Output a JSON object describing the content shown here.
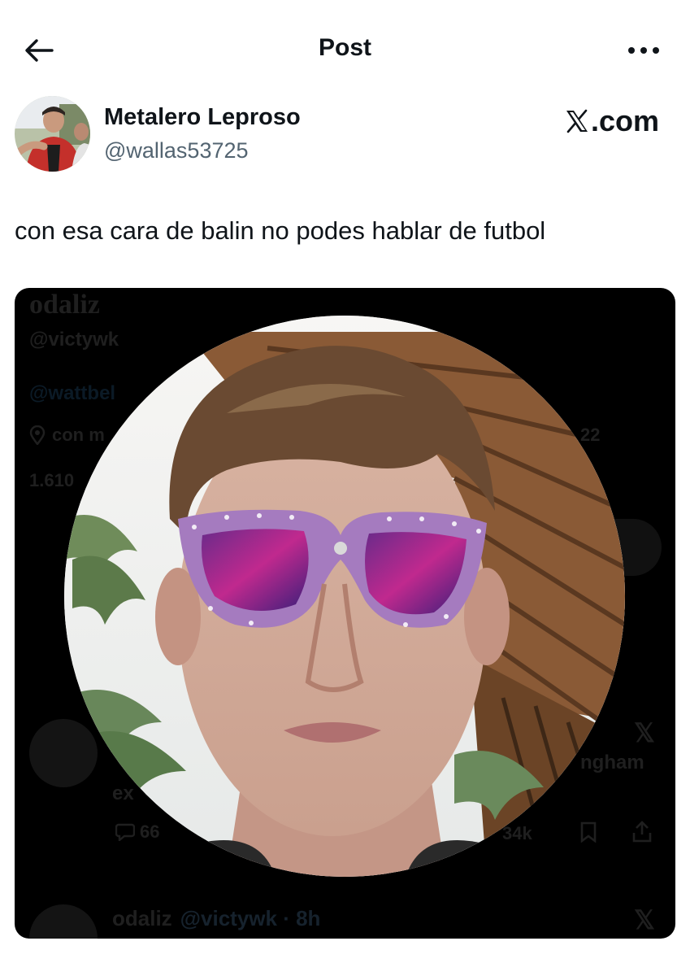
{
  "topbar": {
    "title": "Post",
    "back_icon": "arrow-left-icon",
    "more_icon": "more-horizontal-icon"
  },
  "author": {
    "display_name": "Metalero Leproso",
    "handle": "@wallas53725"
  },
  "watermark": {
    "text": ".com",
    "logo_icon": "x-logo-icon"
  },
  "tweet": {
    "text": "con esa cara de balin no podes hablar de futbol"
  },
  "embedded_screenshot": {
    "profile_name": "odaliz",
    "profile_handle": "@victywk",
    "mention": "@wattbel",
    "location_partial": "con m",
    "stat_partial": "1.610",
    "date_partial": "22",
    "reply_partial_1": "ngham",
    "reply_partial_2": "ex",
    "reply_count": "66",
    "like_count": "34k",
    "footer_name": "odaliz",
    "footer_meta": "@victywk · 8h"
  },
  "colors": {
    "text_primary": "#0f1419",
    "text_secondary": "#536471",
    "media_background": "#000000"
  }
}
